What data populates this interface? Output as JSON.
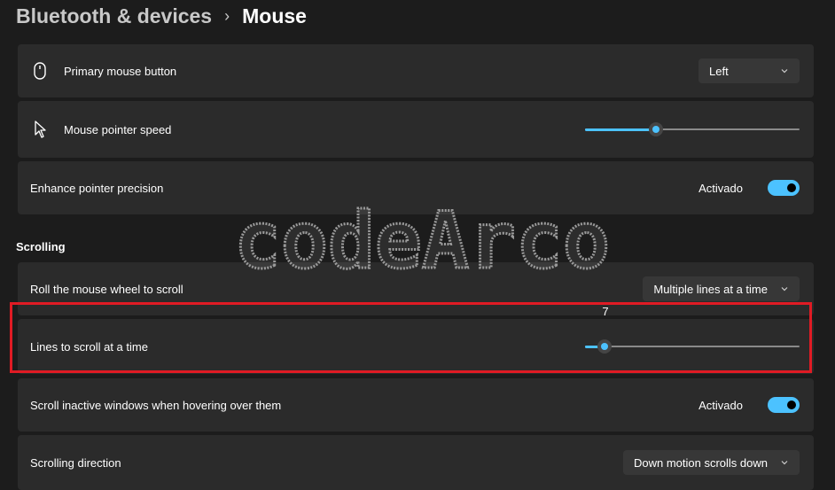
{
  "breadcrumb": {
    "parent": "Bluetooth & devices",
    "separator": "›",
    "current": "Mouse"
  },
  "rows": {
    "primary_button": {
      "label": "Primary mouse button",
      "value": "Left",
      "icon": "mouse-icon"
    },
    "pointer_speed": {
      "label": "Mouse pointer speed",
      "level": 0.33,
      "icon": "cursor-icon"
    },
    "enhance_precision": {
      "label": "Enhance pointer precision",
      "state": "Activado",
      "on": true
    }
  },
  "scrolling": {
    "title": "Scrolling",
    "wheel": {
      "label": "Roll the mouse wheel to scroll",
      "value": "Multiple lines at a time"
    },
    "lines": {
      "label": "Lines to scroll at a time",
      "value": "7",
      "level": 0.09
    },
    "inactive": {
      "label": "Scroll inactive windows when hovering over them",
      "state": "Activado",
      "on": true
    },
    "direction": {
      "label": "Scrolling direction",
      "value": "Down motion scrolls down"
    }
  },
  "watermark": {
    "text": "codeArco"
  },
  "colors": {
    "accent": "#4cc2ff",
    "highlight": "#e01b24",
    "background": "#1c1c1c",
    "card": "#2b2b2b"
  }
}
